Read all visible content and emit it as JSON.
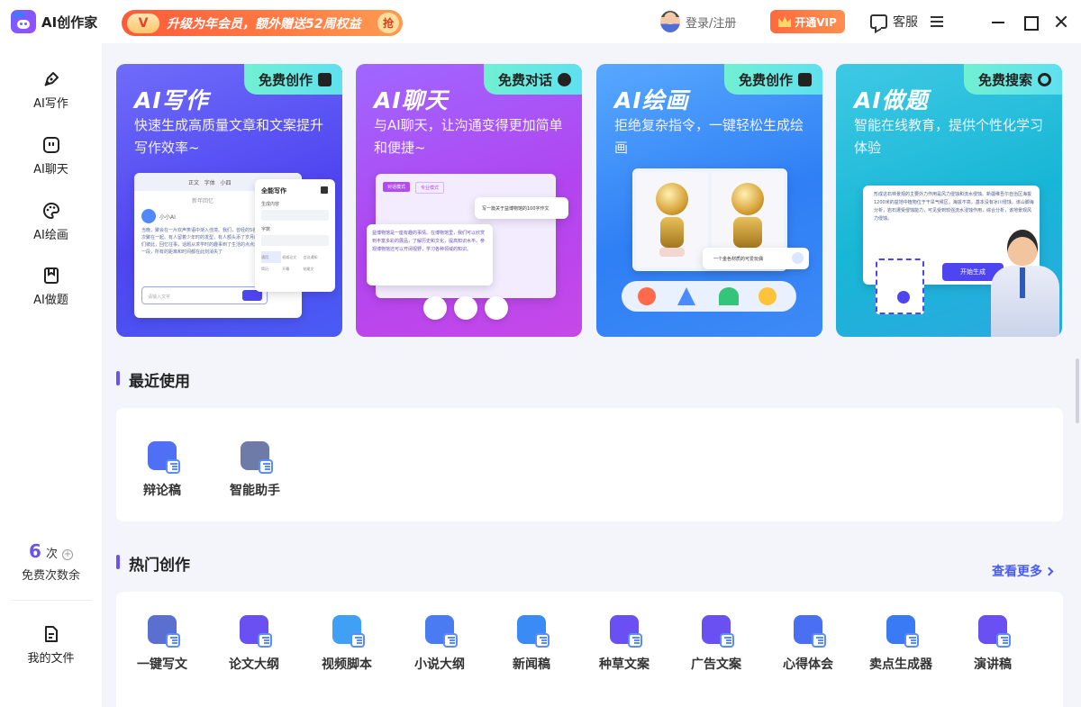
{
  "app": {
    "title": "AI创作家",
    "logo": "robot-face-icon"
  },
  "header": {
    "promo_badge": "V",
    "promo_text": "升级为年会员，额外赠送52周权益",
    "promo_action": "抢",
    "login_text": "登录/注册",
    "vip_label": "开通VIP",
    "service_label": "客服"
  },
  "sidebar": {
    "items": [
      {
        "label": "AI写作",
        "icon": "pen-icon"
      },
      {
        "label": "AI聊天",
        "icon": "chat-bot-icon"
      },
      {
        "label": "AI绘画",
        "icon": "palette-icon"
      },
      {
        "label": "AI做题",
        "icon": "bookmark-icon"
      }
    ],
    "credits_value": "6",
    "credits_unit": "次",
    "credits_plus": "+",
    "credits_label": "免费次数余",
    "files_label": "我的文件"
  },
  "banners": [
    {
      "title": "AI写作",
      "desc": "快速生成高质量文章和文案提升写作效率~",
      "tag": "免费创作",
      "tag_icon": "edit-icon"
    },
    {
      "title": "AI聊天",
      "desc": "与AI聊天，让沟通变得更加简单和便捷~",
      "tag": "免费对话",
      "tag_icon": "chat-bubble-icon"
    },
    {
      "title": "AI绘画",
      "desc": "拒绝复杂指令，一键轻松生成绘画",
      "tag": "免费创作",
      "tag_icon": "image-icon"
    },
    {
      "title": "AI做题",
      "desc": "智能在线教育，提供个性化学习体验",
      "tag": "免费搜索",
      "tag_icon": "search-icon"
    }
  ],
  "write_mock": {
    "toolbar_font": "正文",
    "toolbar_family": "字体",
    "toolbar_size": "小四",
    "doc_tab": "新年回忆",
    "bot_name": "小小AI",
    "body_text": "当晚，聚会在一片欢声笑语中渐入佳境。我们，曾经的5名同学，再次聚在一起。有人留着少年时的发型，有人额头添了岁月的皱纹。我们彼此，回忆往事，话题从求学时的趣事到了生活的点点滴滴。往事一段，所有的距离和时间都在此刻消失了",
    "input_placeholder": "请输入文字",
    "panel_title": "全能写作",
    "panel_content_label": "生成内容",
    "panel_count_label": "字数",
    "chips": [
      "通用",
      "权威论文",
      "会议通知",
      "简历",
      "开幕",
      "结尾文"
    ]
  },
  "chat_mock": {
    "mode_a": "对话模式",
    "mode_b": "专业模式",
    "prompt": "写一篇关于益博物馆的100字作文",
    "answer": "益博物馆是一座有趣的事情。在博物馆里，我们可以欣赏到丰富多彩的展品，了解历史和文化，提高知识水平。参观博物馆还可以开阔视野，学习各种领域的知识。"
  },
  "draw_mock": {
    "caption": "一个金色材质的可爱玩偶",
    "tools": [
      "brush-icon",
      "shape-icon",
      "sun-icon",
      "palette-icon"
    ]
  },
  "quiz_mock": {
    "question": "形成这石林景观的主要外力作用是风力侵蚀和流水侵蚀。新疆维吾尔自治区海拔1200米的盆地中植物位于干旱气候区，海拔不高，基本没有冰川侵蚀。该山脚海分析，岩石遭受侵蚀能力，可见受到较强流水浸蚀作用，综合分析，该地景观风力侵蚀。",
    "action_label": "开始生成"
  },
  "recent": {
    "title": "最近使用",
    "items": [
      {
        "label": "辩论稿",
        "icon": "debate-icon",
        "color": "#4f6ff5"
      },
      {
        "label": "智能助手",
        "icon": "assistant-icon",
        "color": "#6e7aa8"
      }
    ]
  },
  "hot": {
    "title": "热门创作",
    "more_label": "查看更多",
    "items": [
      {
        "label": "一键写文",
        "icon": "quick-write-icon",
        "color": "#5a6fd0"
      },
      {
        "label": "论文大纲",
        "icon": "outline-icon",
        "color": "#6a4ff2"
      },
      {
        "label": "视频脚本",
        "icon": "video-script-icon",
        "color": "#3fa0f5"
      },
      {
        "label": "小说大纲",
        "icon": "novel-icon",
        "color": "#4a7bf2"
      },
      {
        "label": "新闻稿",
        "icon": "news-icon",
        "color": "#3a8bf5"
      },
      {
        "label": "种草文案",
        "icon": "recommend-icon",
        "color": "#6a4ff2"
      },
      {
        "label": "广告文案",
        "icon": "megaphone-icon",
        "color": "#6a4ff2"
      },
      {
        "label": "心得体会",
        "icon": "notes-icon",
        "color": "#4a6ff2"
      },
      {
        "label": "卖点生成器",
        "icon": "selling-point-icon",
        "color": "#3a7bf5"
      },
      {
        "label": "演讲稿",
        "icon": "microphone-icon",
        "color": "#6a4ff2"
      }
    ]
  }
}
